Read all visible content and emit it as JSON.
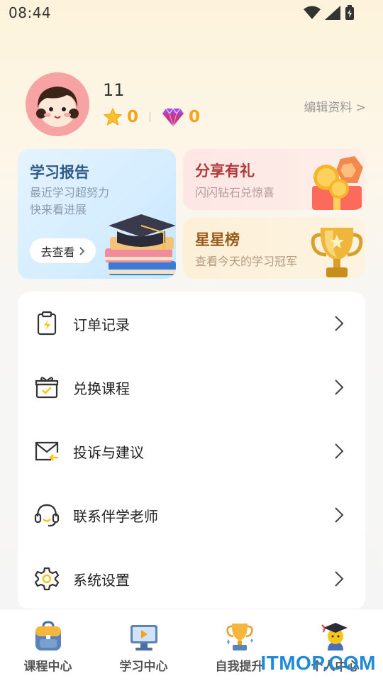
{
  "status_bar": {
    "time": "08:44",
    "icons": [
      "wifi-icon",
      "signal-icon",
      "battery-icon"
    ]
  },
  "profile": {
    "username": "11",
    "stars_count": "0",
    "diamonds_count": "0",
    "edit_label": "编辑资料 >"
  },
  "cards": {
    "report": {
      "title": "学习报告",
      "sub1": "最近学习超努力",
      "sub2": "快来看进展",
      "button": "去查看"
    },
    "share": {
      "title": "分享有礼",
      "sub": "闪闪钻石兑惊喜"
    },
    "stars": {
      "title": "星星榜",
      "sub": "查看今天的学习冠军"
    }
  },
  "menu": [
    {
      "label": "订单记录",
      "icon": "order-clipboard-icon"
    },
    {
      "label": "兑换课程",
      "icon": "gift-box-icon"
    },
    {
      "label": "投诉与建议",
      "icon": "mail-icon"
    },
    {
      "label": "联系伴学老师",
      "icon": "headset-icon"
    },
    {
      "label": "系统设置",
      "icon": "gear-icon"
    }
  ],
  "tabs": [
    {
      "label": "课程中心",
      "icon": "backpack-icon"
    },
    {
      "label": "学习中心",
      "icon": "monitor-icon"
    },
    {
      "label": "自我提升",
      "icon": "trophy-icon"
    },
    {
      "label": "个人中心",
      "icon": "graduate-icon"
    }
  ],
  "watermark": "ITMOP.COM",
  "colors": {
    "accent_orange": "#f5a31a",
    "report_title": "#2d5a8c",
    "share_title": "#b03a3a",
    "stars_title": "#9a5a1a"
  }
}
